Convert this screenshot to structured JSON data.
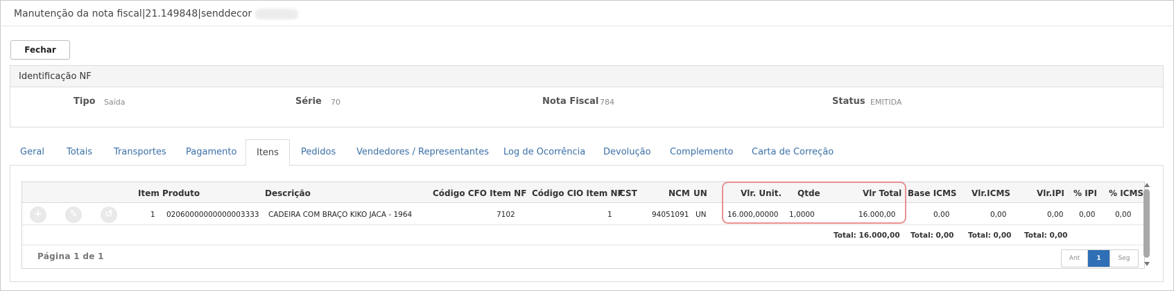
{
  "window": {
    "title": "Manutenção da nota fiscal|21.149848|senddecor"
  },
  "toolbar": {
    "close_label": "Fechar"
  },
  "identificacao": {
    "heading": "Identificação NF",
    "tipo_label": "Tipo",
    "tipo_value": "Saída",
    "serie_label": "Série",
    "serie_value": "70",
    "nota_label": "Nota Fiscal",
    "nota_value": "784",
    "status_label": "Status",
    "status_value": "EMITIDA"
  },
  "tabs": [
    {
      "label": "Geral"
    },
    {
      "label": "Totais"
    },
    {
      "label": "Transportes"
    },
    {
      "label": "Pagamento"
    },
    {
      "label": "Itens",
      "active": true
    },
    {
      "label": "Pedidos"
    },
    {
      "label": "Vendedores / Representantes"
    },
    {
      "label": "Log de Ocorrência"
    },
    {
      "label": "Devolução"
    },
    {
      "label": "Complemento"
    },
    {
      "label": "Carta de Correção"
    }
  ],
  "grid": {
    "columns": [
      "Item",
      "Produto",
      "Descrição",
      "Código CFO Item NF",
      "Código CIO Item NF",
      "CST",
      "NCM",
      "UN",
      "Vlr. Unit.",
      "Qtde",
      "Vlr Total",
      "Base ICMS",
      "Vlr.ICMS",
      "Vlr.IPI",
      "% IPI",
      "% ICMS"
    ],
    "rows": [
      {
        "item": "1",
        "produto": "02060000000000003333",
        "descricao": "CADEIRA COM BRAÇO KIKO JACA - 1964",
        "cfo": "7102",
        "cio": "1",
        "cst": "",
        "ncm": "94051091",
        "un": "UN",
        "vlr_unit": "16.000,00000",
        "qtde": "1,0000",
        "vlr_total": "16.000,00",
        "base_icms": "0,00",
        "vlr_icms": "0,00",
        "vlr_ipi": "0,00",
        "pct_ipi": "0,00",
        "pct_icms": "0,00"
      }
    ],
    "row_actions": [
      "add-icon",
      "edit-icon",
      "history-icon"
    ],
    "totals": {
      "vlr_total": "Total: 16.000,00",
      "base_icms": "Total: 0,00",
      "vlr_icms": "Total: 0,00",
      "vlr_ipi": "Total: 0,00"
    },
    "pagination": {
      "info": "Página 1 de 1",
      "prev": "Ant",
      "current": "1",
      "next": "Seg"
    }
  },
  "colors": {
    "tab_link": "#3a6fa6",
    "pager_active": "#2f6fb5",
    "highlight": "#e98f8f"
  }
}
